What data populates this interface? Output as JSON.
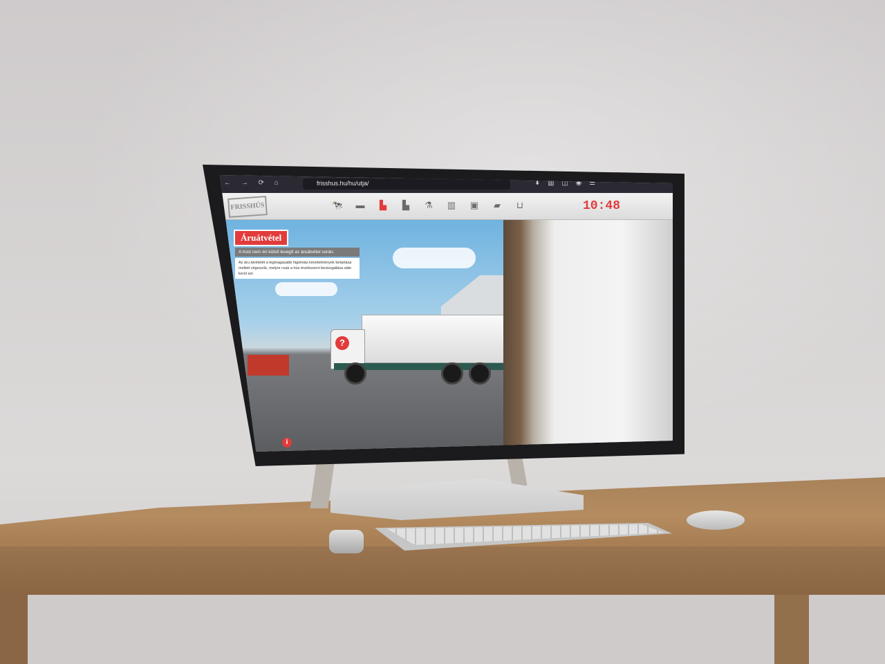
{
  "browser": {
    "url": "frisshus.hu/hu/utja/"
  },
  "site": {
    "logo_text": "FRISSHÚS",
    "clock": "10:48",
    "nav_icons": [
      "cow-icon",
      "truck-icon",
      "factory-active-icon",
      "factory-icon",
      "microscope-icon",
      "packaging-icon",
      "box-icon",
      "delivery-truck-icon",
      "basket-icon"
    ]
  },
  "content": {
    "title": "Áruátvétel",
    "subtitle": "A húst nem éri külső levegő az áruátvétel során.",
    "body": "Az áru átvételét a legmagasabb higiéniás követelmények betartása mellett végezzük, melyre csak a hús érzékszervi bevizsgálása után kerül sor.",
    "hotspot_label": "?",
    "info_label": "i"
  },
  "colors": {
    "accent": "#e23b3b",
    "browser_bar": "#2b2a33"
  }
}
